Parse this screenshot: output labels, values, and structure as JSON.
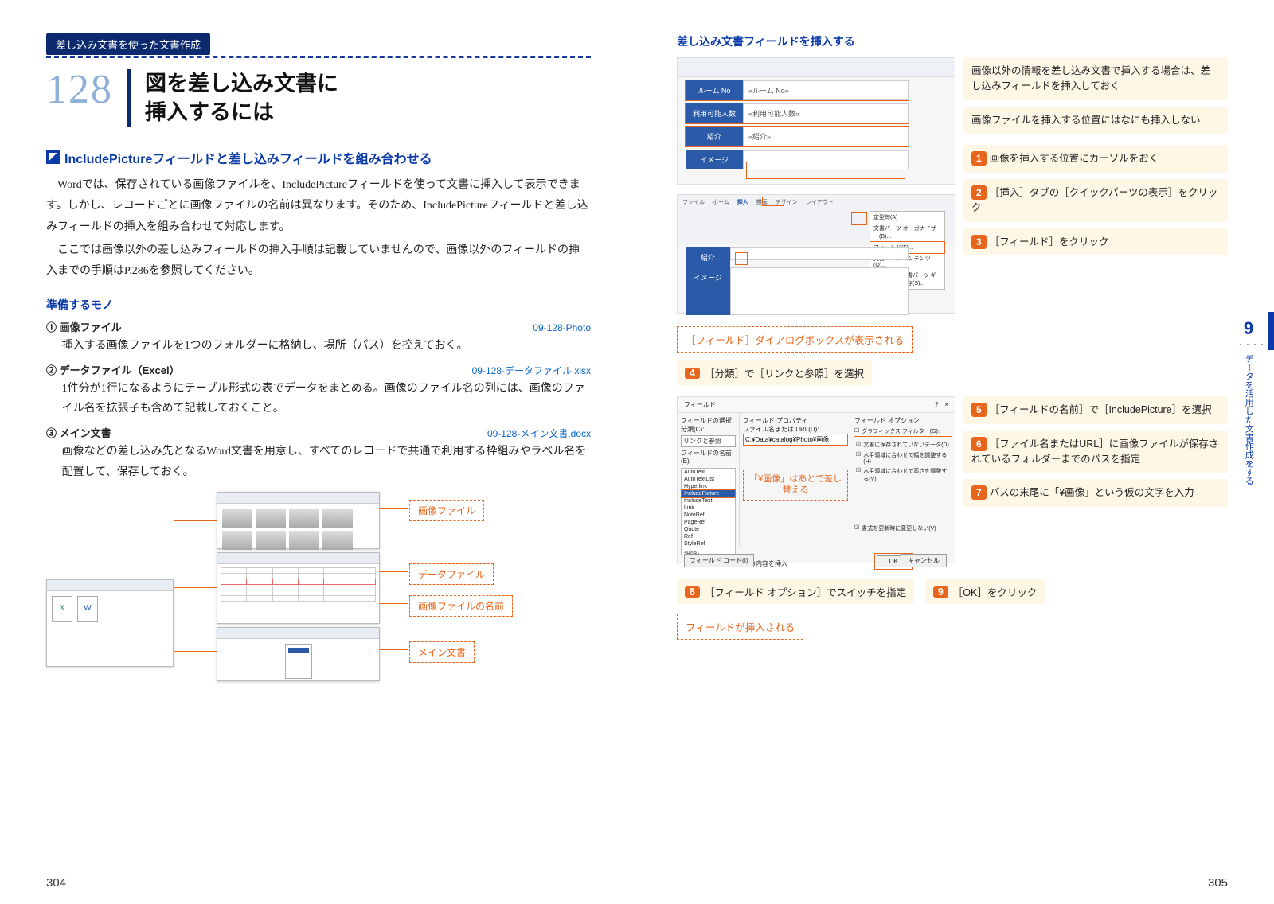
{
  "pageLeft": 304,
  "pageRight": 305,
  "chapter": {
    "num": "9",
    "label": "データを活用した文書作成をする"
  },
  "crumb": "差し込み文書を使った文書作成",
  "tipNumber": "128",
  "title": "図を差し込み文書に\n挿入するには",
  "section1": "IncludePictureフィールドと差し込みフィールドを組み合わせる",
  "para1": "Wordでは、保存されている画像ファイルを、IncludePictureフィールドを使って文書に挿入して表示できます。しかし、レコードごとに画像ファイルの名前は異なります。そのため、IncludePictureフィールドと差し込みフィールドの挿入を組み合わせて対応します。",
  "para2": "ここでは画像以外の差し込みフィールドの挿入手順は記載していませんので、画像以外のフィールドの挿入までの手順はP.286を参照してください。",
  "prepHead": "準備するモノ",
  "prep": [
    {
      "n": "①",
      "label": "画像ファイル",
      "file": "09-128-Photo",
      "desc": "挿入する画像ファイルを1つのフォルダーに格納し、場所（パス）を控えておく。"
    },
    {
      "n": "②",
      "label": "データファイル（Excel）",
      "file": "09-128-データファイル.xlsx",
      "desc": "1件分が1行になるようにテーブル形式の表でデータをまとめる。画像のファイル名の列には、画像のファイル名を拡張子も含めて記載しておくこと。"
    },
    {
      "n": "③",
      "label": "メイン文書",
      "file": "09-128-メイン文書.docx",
      "desc": "画像などの差し込み先となるWord文書を用意し、すべてのレコードで共通で利用する枠組みやラベル名を配置して、保存しておく。"
    }
  ],
  "tags": {
    "img": "画像ファイル",
    "data": "データファイル",
    "imgname": "画像ファイルの名前",
    "main": "メイン文書"
  },
  "rhead": "差し込み文書フィールドを挿入する",
  "form": {
    "rows": [
      {
        "lab": "ルーム No",
        "val": "«ルーム No»"
      },
      {
        "lab": "利用可能人数",
        "val": "«利用可能人数»"
      },
      {
        "lab": "紹介",
        "val": "«紹介»"
      },
      {
        "lab": "イメージ",
        "val": ""
      }
    ]
  },
  "cream": {
    "a": "画像以外の情報を差し込み文書で挿入する場合は、差し込みフィールドを挿入しておく",
    "b": "画像ファイルを挿入する位置にはなにも挿入しない",
    "s1": "画像を挿入する位置にカーソルをおく",
    "s2": "［挿入］タブの［クイックパーツの表示］をクリック",
    "s3": "［フィールド］をクリック",
    "box1": "［フィールド］ダイアログボックスが表示される",
    "s4": "［分類］で［リンクと参照］を選択",
    "s5": "［フィールドの名前］で［IncludePicture］を選択",
    "s6": "［ファイル名またはURL］に画像ファイルが保存されているフォルダーまでのパスを指定",
    "s7": "パスの末尾に「¥画像」という仮の文字を入力",
    "s8": "［フィールド オプション］でスイッチを指定",
    "s9": "［OK］をクリック",
    "box2": "フィールドが挿入される",
    "replace": "「¥画像」はあとで差し替える"
  },
  "dlg": {
    "title": "フィールド",
    "catLabel": "フィールドの選択",
    "cat": "リンクと参照",
    "nameLabel": "フィールドの名前(E):",
    "names": [
      "AutoText",
      "AutoTextList",
      "Hyperlink",
      "IncludePicture",
      "IncludeText",
      "Link",
      "NoteRef",
      "PageRef",
      "Quote",
      "Ref",
      "StyleRef"
    ],
    "propLabel": "フィールド プロパティ",
    "urlLabel": "ファイル名または URL(U):",
    "url": "C:¥Data¥catalog¥Photo¥画像",
    "optLabel": "フィールド オプション",
    "opt0": "グラフィックス フィルター(G):",
    "opt1": "文書に保存されていないデータ(D)",
    "opt2": "水平領域に合わせて幅を調整する(H)",
    "opt3": "水平領域に合わせて高さを調整する(V)",
    "preserve": "書式を更新時に変更しない(V)",
    "descLabel": "説明：",
    "desc": "グラフィック ファイルの内容を挿入",
    "codes": "フィールド コード(I)",
    "ok": "OK",
    "cancel": "キャンセル"
  },
  "ribbon": {
    "tabs": [
      "ファイル",
      "ホーム",
      "挿入",
      "描画",
      "デザイン",
      "レイアウト"
    ],
    "menu": [
      "定型句(A)",
      "文書パーツ オーガナイザー(B)...",
      "フィールド(F)...",
      "文書パーツ コンテンツ(O)...",
      "選択範囲を文書パーツ ギャラリーに保存(S)..."
    ],
    "parts": [
      "紹介",
      "イメージ"
    ]
  }
}
